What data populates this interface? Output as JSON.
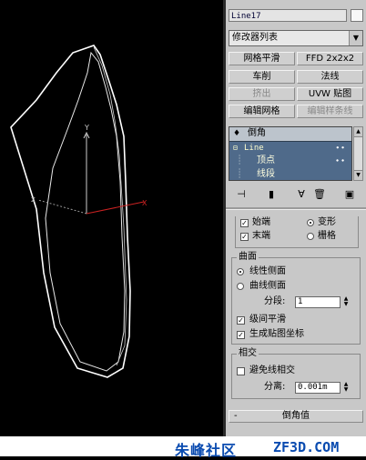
{
  "object_name": "Line17",
  "modifier_list_label": "修改器列表",
  "colors": {
    "viewport_bg": "#000000",
    "panel_bg": "#c8c8c8",
    "stack_bg": "#4f6a8a",
    "x_axis": "#cc2222",
    "y_axis": "#cccccc",
    "brand_text": "#0a4bb0"
  },
  "modifier_buttons": [
    "网格平滑",
    "FFD 2x2x2",
    "车削",
    "法线",
    "挤出",
    "UVW 贴图",
    "编辑网格",
    "编辑样条线"
  ],
  "stack": {
    "items": [
      {
        "label": "倒角",
        "icon": "lightbulb-icon"
      },
      {
        "label": "Line"
      },
      {
        "label": "顶点"
      },
      {
        "label": "线段"
      }
    ]
  },
  "toolbar_icons": [
    "pin-stack-icon",
    "show-end-result-icon",
    "make-unique-icon",
    "remove-modifier-icon",
    "configure-sets-icon"
  ],
  "caps": {
    "start_cap_label": "始端",
    "end_cap_label": "末端",
    "morph_label": "变形",
    "grid_label": "栅格"
  },
  "surface": {
    "title": "曲面",
    "linear_label": "线性侧面",
    "curved_label": "曲线侧面",
    "segments_label": "分段:",
    "segments_value": "1",
    "smooth_across_levels_label": "级间平滑",
    "gen_mapping_coords_label": "生成贴图坐标"
  },
  "intersections": {
    "title": "相交",
    "keep_lines_label": "避免线相交",
    "separation_label": "分离:",
    "separation_value": "0.001m"
  },
  "rollout": {
    "sign": "-",
    "title": "倒角值"
  },
  "watermark": {
    "left": "朱峰社区",
    "right": "ZF3D.COM"
  }
}
